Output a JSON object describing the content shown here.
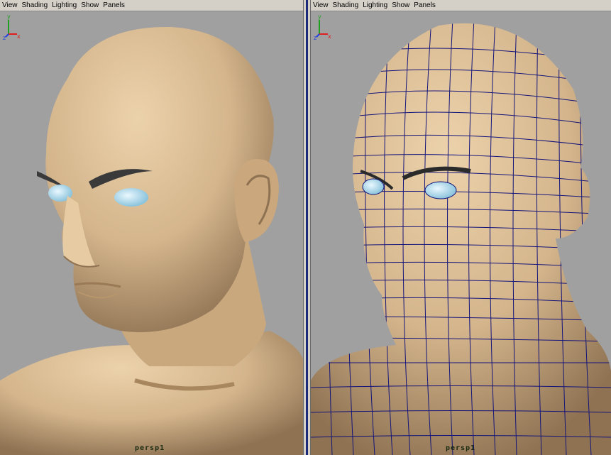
{
  "menus": [
    "View",
    "Shading",
    "Lighting",
    "Show",
    "Panels"
  ],
  "left_panel": {
    "camera_label": "persp1",
    "display_mode": "smooth-shaded"
  },
  "right_panel": {
    "camera_label": "persp1",
    "display_mode": "smooth-shaded-wireframe"
  },
  "axis_labels": {
    "x": "x",
    "y": "y",
    "z": "z"
  },
  "colors": {
    "background": "#a0a0a0",
    "skin": "#d9b991",
    "skin_shadow": "#8e7252",
    "eye": "#bfe6f5",
    "wireframe": "#14147a",
    "active_panel_border": "#1b2a7a",
    "axis_x": "#e02020",
    "axis_y": "#20a020",
    "axis_z": "#2040e0"
  }
}
